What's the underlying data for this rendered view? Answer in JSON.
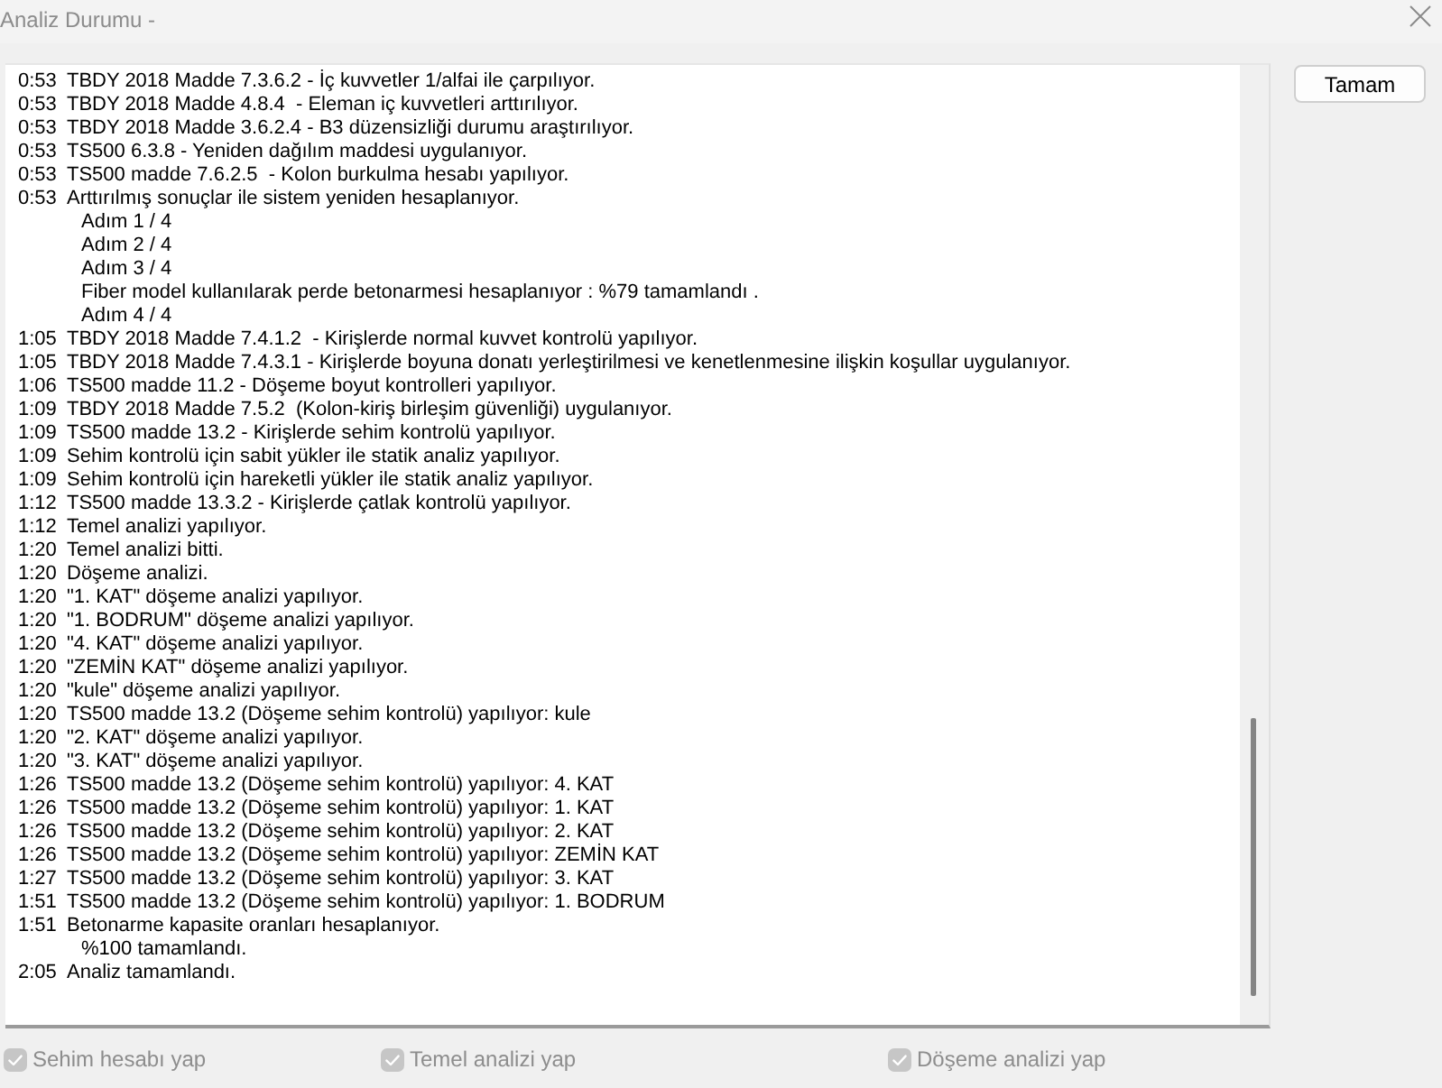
{
  "window": {
    "title": "Analiz Durumu -"
  },
  "log": [
    {
      "kind": "entry",
      "time": "0:53",
      "text": "TBDY 2018 Madde 7.3.6.2 - İç kuvvetler 1/alfai ile çarpılıyor."
    },
    {
      "kind": "entry",
      "time": "0:53",
      "text": "TBDY 2018 Madde 4.8.4  - Eleman iç kuvvetleri arttırılıyor."
    },
    {
      "kind": "entry",
      "time": "0:53",
      "text": "TBDY 2018 Madde 3.6.2.4 - B3 düzensizliği durumu araştırılıyor."
    },
    {
      "kind": "entry",
      "time": "0:53",
      "text": "TS500 6.3.8 - Yeniden dağılım maddesi uygulanıyor."
    },
    {
      "kind": "entry",
      "time": "0:53",
      "text": "TS500 madde 7.6.2.5  - Kolon burkulma hesabı yapılıyor."
    },
    {
      "kind": "entry",
      "time": "0:53",
      "text": "Arttırılmış sonuçlar ile sistem yeniden hesaplanıyor."
    },
    {
      "kind": "step",
      "text": "Adım 1 / 4"
    },
    {
      "kind": "step",
      "text": "Adım 2 / 4"
    },
    {
      "kind": "step",
      "text": "Adım 3 / 4"
    },
    {
      "kind": "step",
      "text": "Fiber model kullanılarak perde betonarmesi hesaplanıyor : %79 tamamlandı ."
    },
    {
      "kind": "step",
      "text": "Adım 4 / 4"
    },
    {
      "kind": "entry",
      "time": "1:05",
      "text": "TBDY 2018 Madde 7.4.1.2  - Kirişlerde normal kuvvet kontrolü yapılıyor."
    },
    {
      "kind": "entry",
      "time": "1:05",
      "text": "TBDY 2018 Madde 7.4.3.1 - Kirişlerde boyuna donatı yerleştirilmesi ve kenetlenmesine ilişkin koşullar uygulanıyor."
    },
    {
      "kind": "entry",
      "time": "1:06",
      "text": "TS500 madde 11.2 - Döşeme boyut kontrolleri yapılıyor."
    },
    {
      "kind": "entry",
      "time": "1:09",
      "text": "TBDY 2018 Madde 7.5.2  (Kolon-kiriş birleşim güvenliği) uygulanıyor."
    },
    {
      "kind": "entry",
      "time": "1:09",
      "text": "TS500 madde 13.2 - Kirişlerde sehim kontrolü yapılıyor."
    },
    {
      "kind": "entry",
      "time": "1:09",
      "text": "Sehim kontrolü için sabit yükler ile statik analiz yapılıyor."
    },
    {
      "kind": "entry",
      "time": "1:09",
      "text": "Sehim kontrolü için hareketli yükler ile statik analiz yapılıyor."
    },
    {
      "kind": "entry",
      "time": "1:12",
      "text": "TS500 madde 13.3.2 - Kirişlerde çatlak kontrolü yapılıyor."
    },
    {
      "kind": "entry",
      "time": "1:12",
      "text": "Temel analizi yapılıyor."
    },
    {
      "kind": "entry",
      "time": "1:20",
      "text": "Temel analizi bitti."
    },
    {
      "kind": "entry",
      "time": "1:20",
      "text": "Döşeme analizi."
    },
    {
      "kind": "entry",
      "time": "1:20",
      "text": "\"1. KAT\" döşeme analizi yapılıyor."
    },
    {
      "kind": "entry",
      "time": "1:20",
      "text": "\"1. BODRUM\" döşeme analizi yapılıyor."
    },
    {
      "kind": "entry",
      "time": "1:20",
      "text": "\"4. KAT\" döşeme analizi yapılıyor."
    },
    {
      "kind": "entry",
      "time": "1:20",
      "text": "\"ZEMİN KAT\" döşeme analizi yapılıyor."
    },
    {
      "kind": "entry",
      "time": "1:20",
      "text": "\"kule\" döşeme analizi yapılıyor."
    },
    {
      "kind": "entry",
      "time": "1:20",
      "text": "TS500 madde 13.2 (Döşeme sehim kontrolü) yapılıyor: kule"
    },
    {
      "kind": "entry",
      "time": "1:20",
      "text": "\"2. KAT\" döşeme analizi yapılıyor."
    },
    {
      "kind": "entry",
      "time": "1:20",
      "text": "\"3. KAT\" döşeme analizi yapılıyor."
    },
    {
      "kind": "entry",
      "time": "1:26",
      "text": "TS500 madde 13.2 (Döşeme sehim kontrolü) yapılıyor: 4. KAT"
    },
    {
      "kind": "entry",
      "time": "1:26",
      "text": "TS500 madde 13.2 (Döşeme sehim kontrolü) yapılıyor: 1. KAT"
    },
    {
      "kind": "entry",
      "time": "1:26",
      "text": "TS500 madde 13.2 (Döşeme sehim kontrolü) yapılıyor: 2. KAT"
    },
    {
      "kind": "entry",
      "time": "1:26",
      "text": "TS500 madde 13.2 (Döşeme sehim kontrolü) yapılıyor: ZEMİN KAT"
    },
    {
      "kind": "entry",
      "time": "1:27",
      "text": "TS500 madde 13.2 (Döşeme sehim kontrolü) yapılıyor: 3. KAT"
    },
    {
      "kind": "entry",
      "time": "1:51",
      "text": "TS500 madde 13.2 (Döşeme sehim kontrolü) yapılıyor: 1. BODRUM"
    },
    {
      "kind": "entry",
      "time": "1:51",
      "text": "Betonarme kapasite oranları hesaplanıyor."
    },
    {
      "kind": "step",
      "text": "%100 tamamlandı."
    },
    {
      "kind": "entry",
      "time": "2:05",
      "text": "Analiz tamamlandı."
    }
  ],
  "ok_button": {
    "label": "Tamam"
  },
  "options": [
    {
      "label": "Sehim hesabı yap",
      "checked": true,
      "disabled": true
    },
    {
      "label": "Temel analizi yap",
      "checked": true,
      "disabled": true
    },
    {
      "label": "Döşeme analizi yap",
      "checked": true,
      "disabled": true
    }
  ]
}
